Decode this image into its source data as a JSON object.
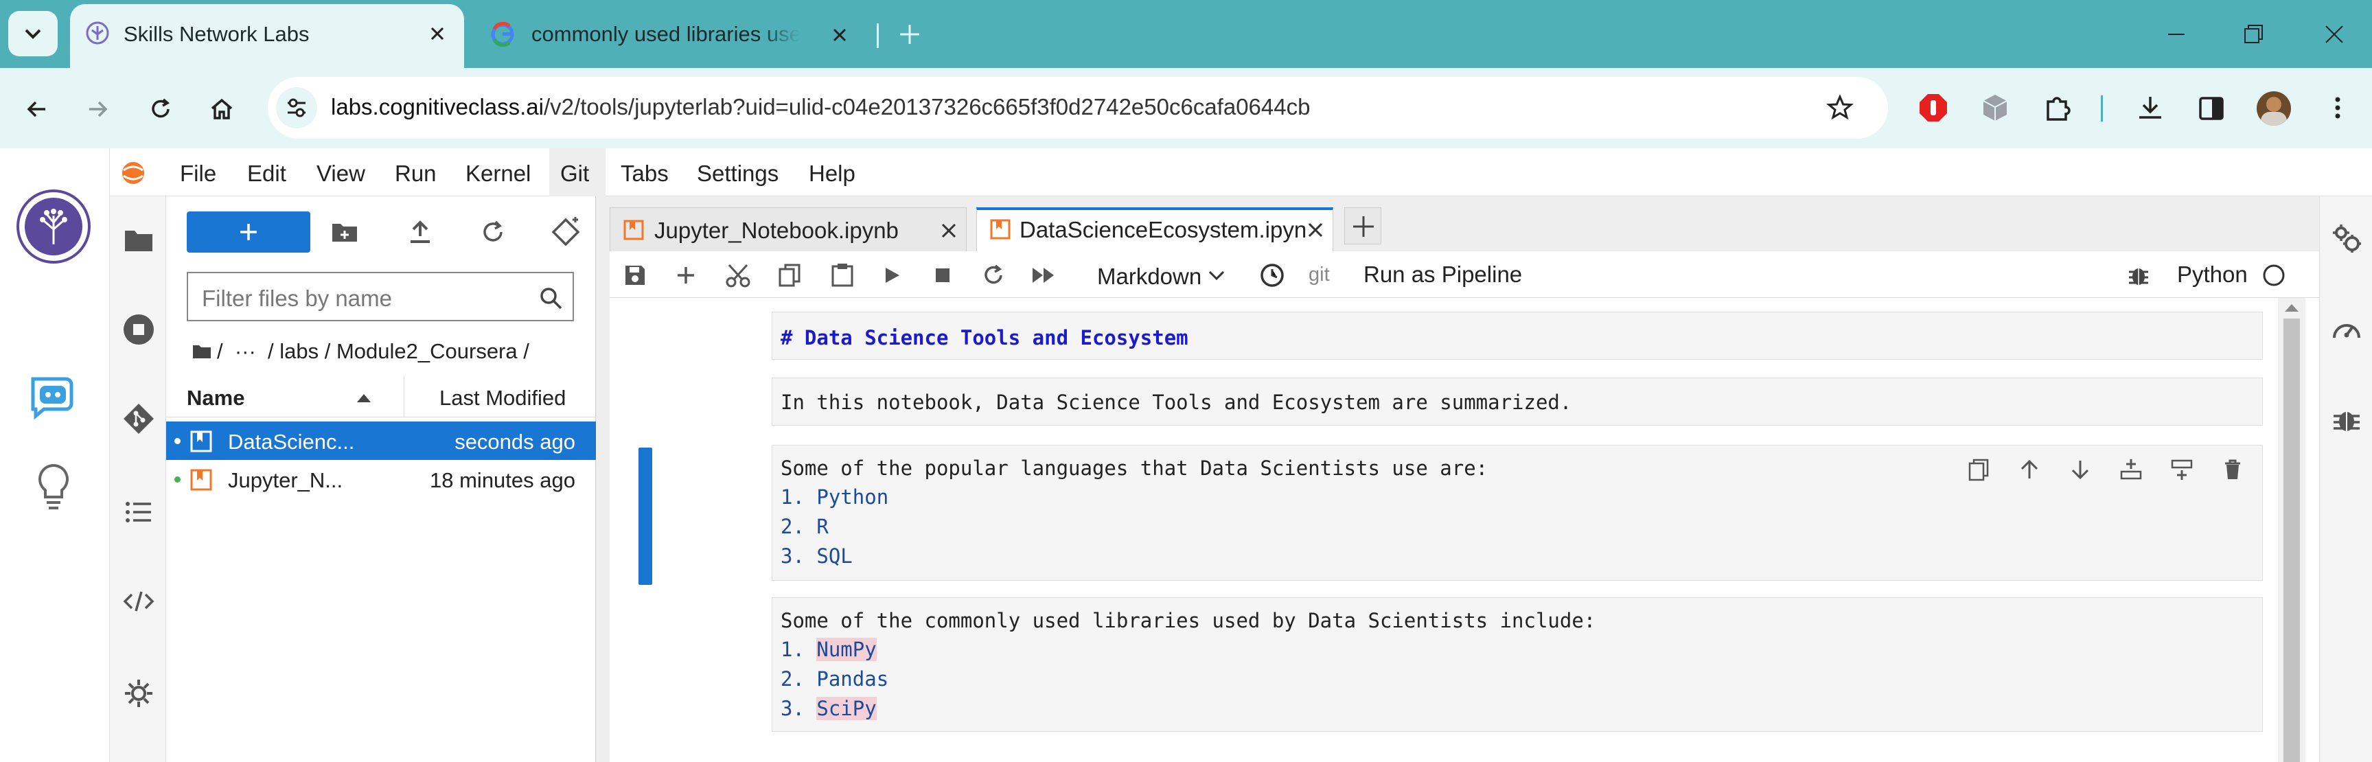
{
  "browser": {
    "tabs": [
      {
        "title": "Skills Network Labs",
        "active": true
      },
      {
        "title": "commonly used libraries used b",
        "active": false
      }
    ],
    "url_host": "labs.cognitiveclass.ai",
    "url_path": "/v2/tools/jupyterlab?uid=ulid-c04e20137326c665f3f0d2742e50c6cafa0644cb"
  },
  "jupyter": {
    "menu": [
      "File",
      "Edit",
      "View",
      "Run",
      "Kernel",
      "Git",
      "Tabs",
      "Settings",
      "Help"
    ],
    "filebrowser": {
      "filter_placeholder": "Filter files by name",
      "breadcrumb": "/  ···  / labs / Module2_Coursera /",
      "col_name": "Name",
      "col_modified": "Last Modified",
      "files": [
        {
          "name": "DataScienc...",
          "modified": "seconds ago",
          "selected": true
        },
        {
          "name": "Jupyter_N...",
          "modified": "18 minutes ago",
          "selected": false
        }
      ]
    },
    "doc_tabs": [
      "Jupyter_Notebook.ipynb",
      "DataScienceEcosystem.ipyn"
    ],
    "nb_toolbar": {
      "cell_type": "Markdown",
      "git": "git",
      "run_pipeline": "Run as Pipeline",
      "kernel": "Python"
    },
    "cells": {
      "c1": "# Data Science Tools and Ecosystem",
      "c2": "In this notebook, Data Science Tools and Ecosystem are summarized.",
      "c3_intro": "Some of the popular languages that Data Scientists use are:",
      "c3_items": [
        "Python",
        "R",
        "SQL"
      ],
      "c4_intro": "Some of the commonly used libraries used by Data Scientists include:",
      "c4_items": [
        "NumPy",
        "Pandas",
        "SciPy"
      ],
      "numbers": [
        "1.",
        "2.",
        "3."
      ]
    }
  },
  "colors": {
    "accent": "#1976d2",
    "tabstrip": "#4fb0b8",
    "toolbar": "#e6f5f6"
  }
}
